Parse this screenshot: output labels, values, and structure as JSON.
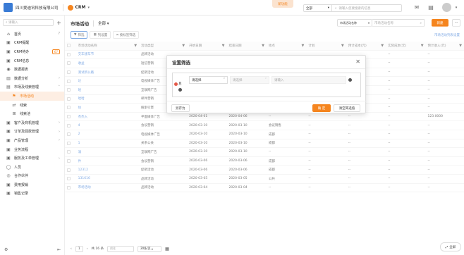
{
  "header": {
    "company": "四川爱迪讯科技有限公司",
    "app": "CRM",
    "new_version": "新功能",
    "search_scope": "全部",
    "search_placeholder": "请输入您要搜索的信息"
  },
  "sidebar": {
    "search_placeholder": "请输入",
    "items": [
      {
        "label": "首页",
        "icon": "home-icon"
      },
      {
        "label": "CRM提醒",
        "icon": "bell-icon"
      },
      {
        "label": "CRM待办",
        "icon": "todo-icon",
        "badge": "67"
      },
      {
        "label": "CRM信息",
        "icon": "message-icon"
      },
      {
        "label": "数据报表",
        "icon": "report-icon"
      },
      {
        "label": "数据分析",
        "icon": "analysis-icon"
      },
      {
        "label": "市场及线索管理",
        "icon": "market-icon"
      },
      {
        "label": "市场活动",
        "icon": "flag-icon",
        "active": true
      },
      {
        "label": "线索",
        "icon": "lead-icon"
      },
      {
        "label": "线索池",
        "icon": "pool-icon"
      },
      {
        "label": "客户及商机管理",
        "icon": "customer-icon"
      },
      {
        "label": "订单及回款管理",
        "icon": "order-icon"
      },
      {
        "label": "产品管理",
        "icon": "product-icon"
      },
      {
        "label": "业务流程",
        "icon": "flow-icon"
      },
      {
        "label": "服务及工单管理",
        "icon": "service-icon"
      },
      {
        "label": "人员",
        "icon": "person-icon"
      },
      {
        "label": "合作伙伴",
        "icon": "partner-icon"
      },
      {
        "label": "费用报销",
        "icon": "expense-icon"
      },
      {
        "label": "销售记录",
        "icon": "record-icon"
      }
    ]
  },
  "main": {
    "title": "市场活动",
    "view": "全部",
    "search_field": "市场活动名称",
    "search_placeholder": "市场活动名称",
    "new_label": "新建",
    "more_label": "···",
    "toolbar": [
      "筛选",
      "列设置",
      "按标签筛选"
    ],
    "col_settings": "市场活动列表设置",
    "columns": [
      "市场活动名称",
      "活动类型",
      "开始日期",
      "结束日期",
      "地点",
      "计划",
      "预计成本(元)",
      "实际成本(元)",
      "预计收入(元)",
      "负责人"
    ],
    "rows": [
      [
        "交车建车节",
        "品牌活动",
        "",
        "",
        "",
        "",
        "",
        "--",
        "--",
        ""
      ],
      [
        "收益",
        "短信营销",
        "",
        "",
        "",
        "",
        "",
        "--",
        "--",
        ""
      ],
      [
        "测试新公路",
        "促销活动",
        "",
        "",
        "",
        "",
        "",
        "--",
        "--",
        ""
      ],
      [
        "达",
        "电视媒体广告",
        "",
        "",
        "",
        "",
        "",
        "--",
        "--",
        ""
      ],
      [
        "哈",
        "互联网广告",
        "",
        "",
        "",
        "",
        "",
        "--",
        "--",
        ""
      ],
      [
        "哈哈",
        "邮件营销",
        "2020-04-02",
        "2020-04-02",
        "--",
        "--",
        "--",
        "--",
        "--",
        ""
      ],
      [
        "住",
        "搜索引擎",
        "2020-04-02",
        "2020-04-02",
        "--",
        "--",
        "--",
        "--",
        "--",
        ""
      ],
      [
        "杰杰入",
        "平面媒体广告",
        "2020-04-01",
        "2020-04-06",
        "--",
        "--",
        "--",
        "--",
        "123.0000",
        ""
      ],
      [
        "4",
        "会议营销",
        "2020-03-10",
        "2020-03-10",
        "会议销售",
        "--",
        "--",
        "--",
        "--",
        ""
      ],
      [
        "2",
        "电视媒体广告",
        "2020-03-10",
        "2020-03-10",
        "成都",
        "--",
        "--",
        "--",
        "--",
        ""
      ],
      [
        "1",
        "关系公关",
        "2020-03-10",
        "2020-03-10",
        "成都",
        "--",
        "--",
        "--",
        "--",
        ""
      ],
      [
        "涌",
        "互联网广告",
        "2020-03-10",
        "2020-03-10",
        "--",
        "--",
        "--",
        "--",
        "--",
        ""
      ],
      [
        "件",
        "会议营销",
        "2020-03-06",
        "2020-03-06",
        "成都",
        "--",
        "--",
        "--",
        "--",
        ""
      ],
      [
        "12312",
        "促销活动",
        "2020-03-06",
        "2020-03-06",
        "成都",
        "--",
        "--",
        "--",
        "--",
        ""
      ],
      [
        "131616",
        "品牌活动",
        "2020-03-05",
        "2020-03-05",
        "公共",
        "--",
        "--",
        "--",
        "--",
        ""
      ],
      [
        "市场活动",
        "品牌活动",
        "2020-03-04",
        "2020-03-04",
        "--",
        "--",
        "--",
        "--",
        "--",
        ""
      ]
    ],
    "pager": {
      "total": "共 16 条",
      "goto_placeholder": "前往",
      "page_size": "20条/页"
    },
    "fullscreen": "全屏"
  },
  "modal": {
    "title": "设置筛选",
    "field_value": "请选择",
    "operator_placeholder": "请选择",
    "value_placeholder": "请输入",
    "and_label": "且",
    "save_as": "另存为",
    "ok": "确 定",
    "clear": "清空筛选值"
  },
  "colors": {
    "accent": "#f5851f",
    "link": "#3a7bd5"
  }
}
